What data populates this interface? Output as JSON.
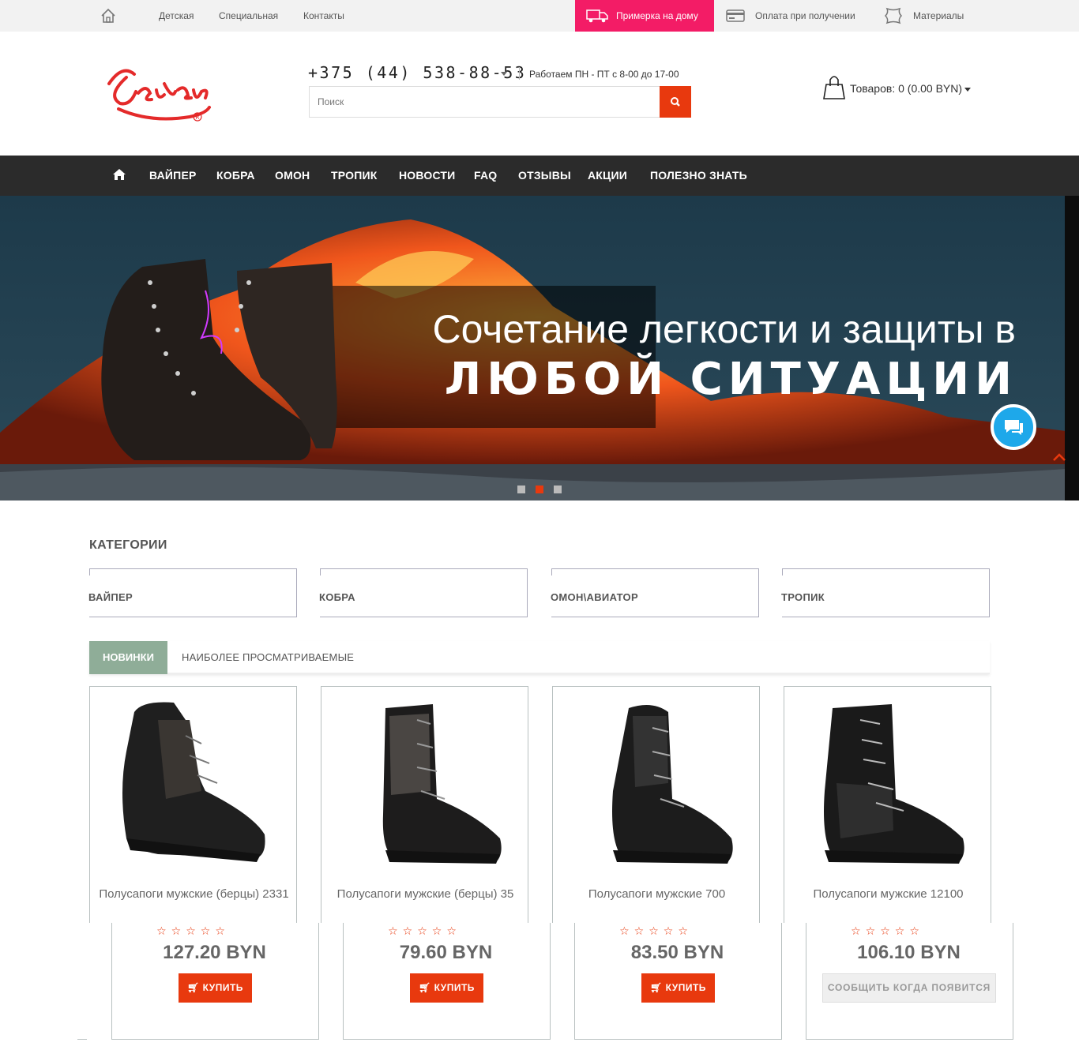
{
  "topbar": {
    "links": [
      "Детская",
      "Специальная",
      "Контакты"
    ],
    "promo_label": "Примерка на дому",
    "payment_label": "Оплата при получении",
    "materials_label": "Материалы"
  },
  "header": {
    "logo_text": "Чевляр",
    "phone": "+375 (44) 538-88-53",
    "hours": "Работаем ПН - ПТ с 8-00 до 17-00",
    "search_placeholder": "Поиск",
    "cart_label": "Товаров: 0 (0.00 BYN)"
  },
  "nav": {
    "items": [
      "ВАЙПЕР",
      "КОБРА",
      "ОМОН",
      "ТРОПИК",
      "НОВОСТИ",
      "FAQ",
      "ОТЗЫВЫ",
      "АКЦИИ",
      "ПОЛЕЗНО ЗНАТЬ"
    ]
  },
  "banner": {
    "line1": "Сочетание легкости и защиты в",
    "line2": "ЛЮБОЙ СИТУАЦИИ",
    "active_slide": 2,
    "slide_count": 3
  },
  "categories": {
    "title": "КАТЕГОРИИ",
    "items": [
      "ВАЙПЕР",
      "КОБРА",
      "ОМОН\\АВИАТОР",
      "ТРОПИК"
    ]
  },
  "tabs": {
    "active": "НОВИНКИ",
    "other": "НАИБОЛЕЕ ПРОСМАТРИВАЕМЫЕ"
  },
  "products": [
    {
      "name": "Полусапоги мужские (берцы) 2331",
      "price": "127.20 BYN",
      "action": "КУПИТЬ",
      "rating": 0
    },
    {
      "name": "Полусапоги мужские (берцы) 35",
      "price": "79.60 BYN",
      "action": "КУПИТЬ",
      "rating": 0
    },
    {
      "name": "Полусапоги мужские 700",
      "price": "83.50 BYN",
      "action": "КУПИТЬ",
      "rating": 0
    },
    {
      "name": "Полусапоги мужские 12100",
      "price": "106.10 BYN",
      "action": "СООБЩИТЬ КОГДА ПОЯВИТСЯ",
      "rating": 0
    }
  ],
  "icons": {
    "home": "home-icon",
    "promo": "truck-icon",
    "payment": "card-icon",
    "materials": "leather-icon",
    "search": "search-icon",
    "cart": "bag-icon",
    "chat": "chat-icon",
    "buy": "cart-icon",
    "star": "star-outline-icon"
  },
  "colors": {
    "accent": "#e8390e",
    "promo": "#f31c66",
    "nav_bg": "#2b2b2b",
    "tab_active": "#8fad98",
    "chat": "#1ea8ea"
  }
}
